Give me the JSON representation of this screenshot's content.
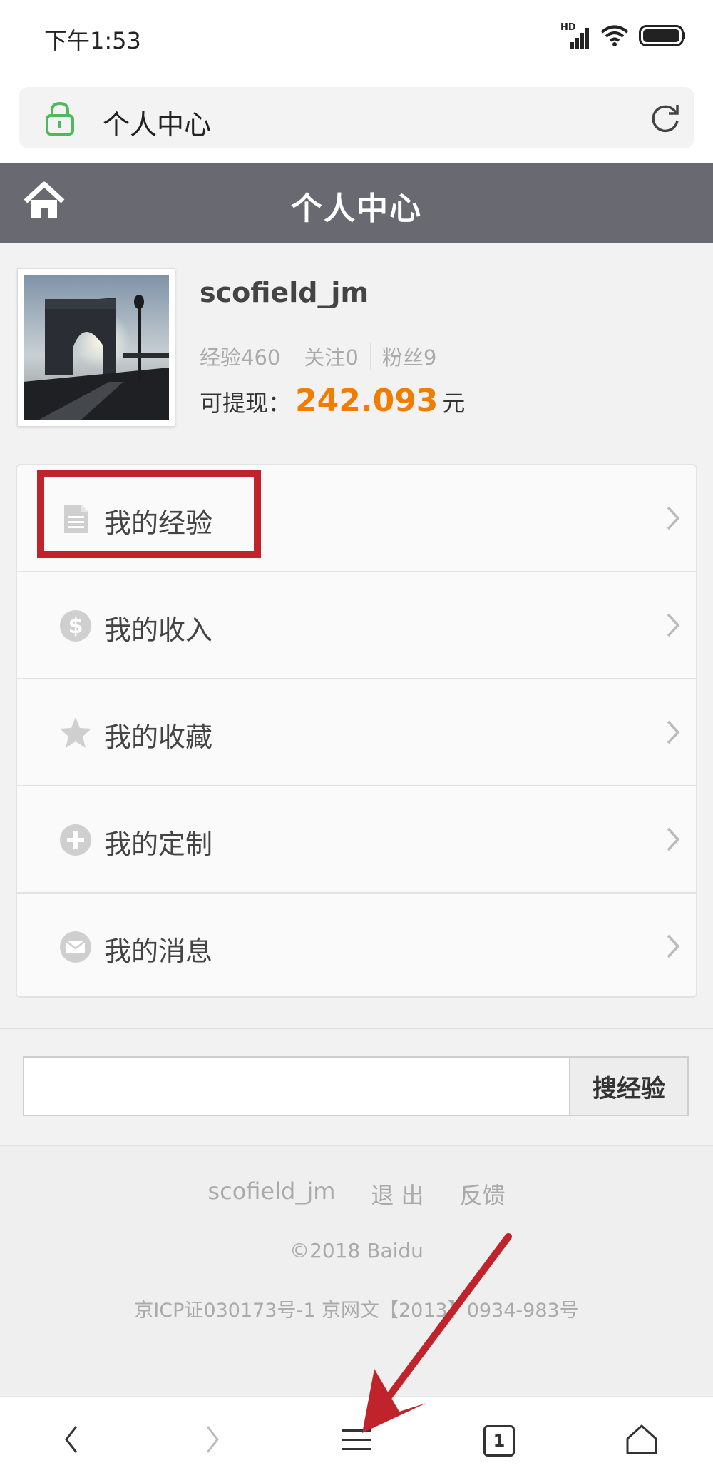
{
  "status_bar": {
    "time": "下午1:53",
    "network_label": "HD"
  },
  "url_bar": {
    "title": "个人中心"
  },
  "header": {
    "title": "个人中心"
  },
  "profile": {
    "username": "scofield_jm",
    "stats": [
      {
        "label": "经验460"
      },
      {
        "label": "关注0"
      },
      {
        "label": "粉丝9"
      }
    ],
    "balance_label": "可提现：",
    "balance_amount": "242.093",
    "balance_unit": "元"
  },
  "menu": {
    "items": [
      {
        "label": "我的经验",
        "icon": "document-icon"
      },
      {
        "label": "我的收入",
        "icon": "dollar-icon"
      },
      {
        "label": "我的收藏",
        "icon": "star-icon"
      },
      {
        "label": "我的定制",
        "icon": "plus-icon"
      },
      {
        "label": "我的消息",
        "icon": "envelope-icon"
      }
    ]
  },
  "search": {
    "value": "",
    "button_label": "搜经验"
  },
  "footer": {
    "links": [
      "scofield_jm",
      "退 出",
      "反馈"
    ],
    "copyright": "©2018 Baidu",
    "icp": "京ICP证030173号-1 京网文【2013】0934-983号"
  },
  "toolbar": {
    "tab_count": "1"
  },
  "colors": {
    "header_bg": "#686971",
    "balance": "#f07d00",
    "highlight": "#c1232a",
    "arrow": "#c1232a"
  }
}
